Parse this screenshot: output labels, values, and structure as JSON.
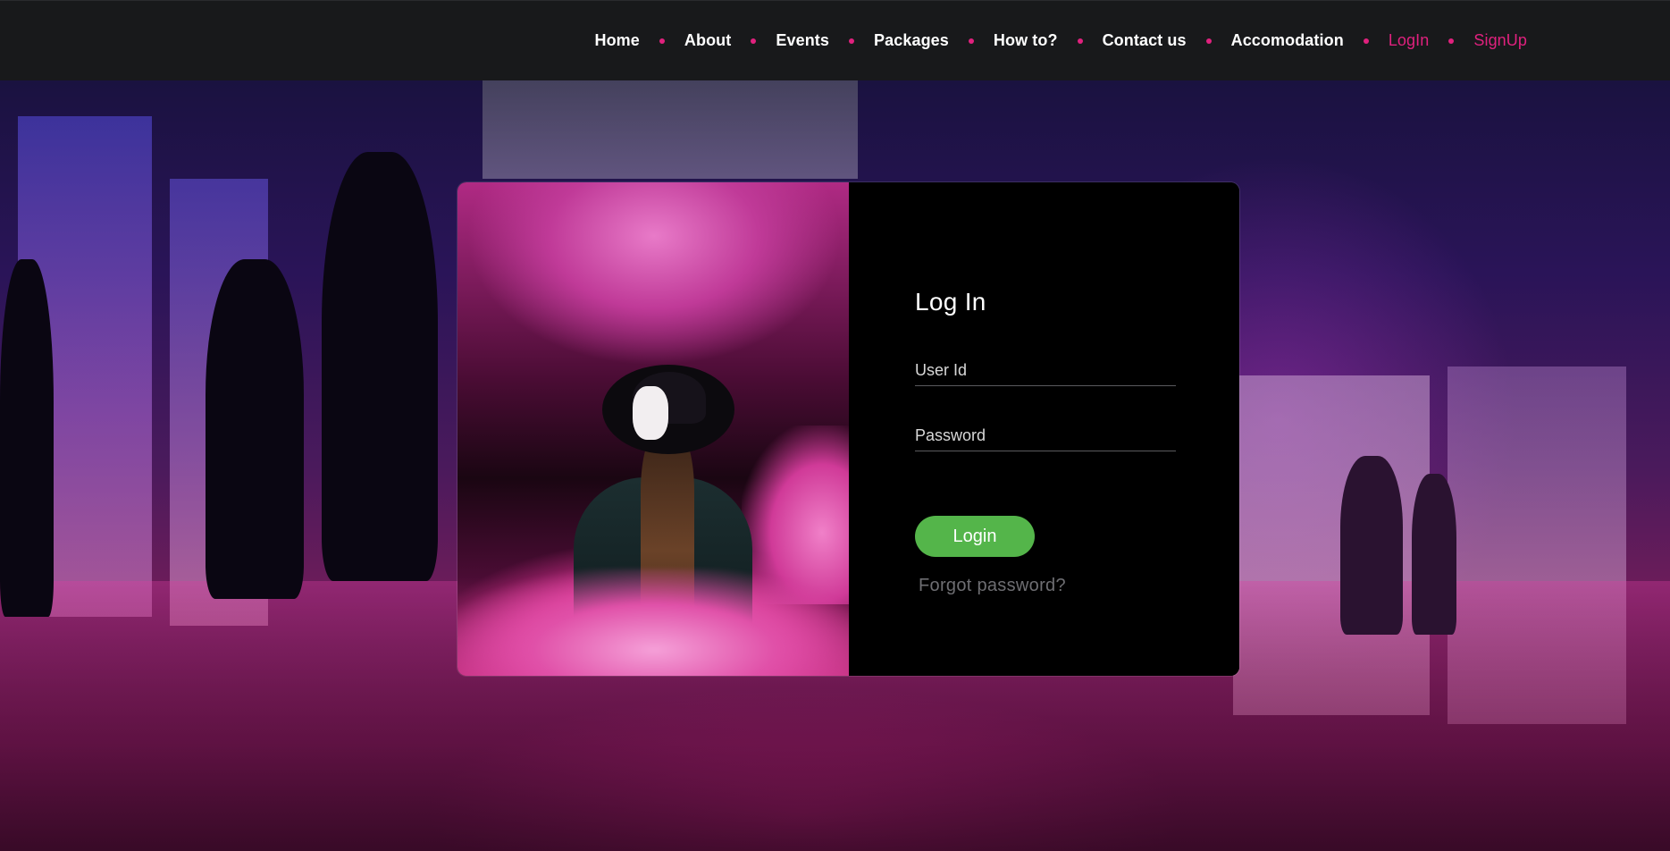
{
  "nav": {
    "items": [
      {
        "label": "Home",
        "active": false
      },
      {
        "label": "About",
        "active": false
      },
      {
        "label": "Events",
        "active": false
      },
      {
        "label": "Packages",
        "active": false
      },
      {
        "label": "How to?",
        "active": false
      },
      {
        "label": "Contact us",
        "active": false
      },
      {
        "label": "Accomodation",
        "active": false
      },
      {
        "label": "LogIn",
        "active": true
      },
      {
        "label": "SignUp",
        "active": true
      }
    ],
    "accent_color": "#e0217e",
    "separator": "dot"
  },
  "login": {
    "title": "Log In",
    "userid_placeholder": "User Id",
    "password_placeholder": "Password",
    "button_label": "Login",
    "button_color": "#54b54a",
    "forgot_label": "Forgot password?"
  }
}
